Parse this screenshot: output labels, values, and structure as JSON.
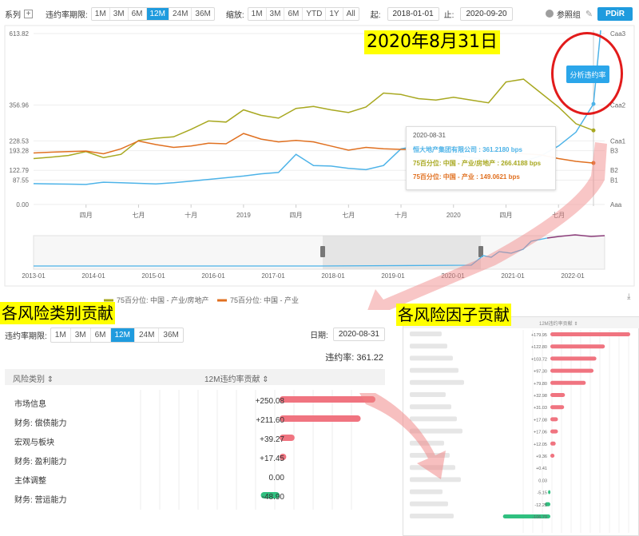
{
  "toolbar": {
    "series_label": "系列",
    "pd_period_label": "违约率期限:",
    "pd_periods": [
      "1M",
      "3M",
      "6M",
      "12M",
      "24M",
      "36M"
    ],
    "pd_period_active": "12M",
    "zoom_label": "缩放:",
    "zoom_options": [
      "1M",
      "3M",
      "6M",
      "YTD",
      "1Y",
      "All"
    ],
    "start_label": "起:",
    "start_date": "2018-01-01",
    "end_label": "止:",
    "end_date": "2020-09-20",
    "ref_group_label": "参照组",
    "pdir_label": "PDiR"
  },
  "annotations": {
    "date_title": "2020年8月31日",
    "left_section_title": "各风险类别贡献",
    "right_section_title": "各风险因子贡献"
  },
  "main_chart": {
    "y_left_ticks": [
      "613.82",
      "356.96",
      "228.53",
      "193.28",
      "122.79",
      "87.55",
      "0.00"
    ],
    "y_right_ticks": [
      "Caa3",
      "Caa2",
      "Caa1",
      "B3",
      "B2",
      "B1",
      "Aaa"
    ],
    "x_ticks": [
      "四月",
      "七月",
      "十月",
      "2019",
      "四月",
      "七月",
      "十月",
      "2020",
      "四月",
      "七月"
    ],
    "analyze_button": "分析违约率",
    "tooltip": {
      "date": "2020-08-31",
      "rows": [
        {
          "text": "恒大地产集团有限公司 : 361.2180 bps",
          "color": "#4db3e8"
        },
        {
          "text": "75百分位: 中国 - 产业/房地产 : 266.4188 bps",
          "color": "#a8a820"
        },
        {
          "text": "75百分位: 中国 - 产业 : 149.0621 bps",
          "color": "#e07020"
        }
      ]
    },
    "navigator_ticks": [
      "2013-01",
      "2014-01",
      "2015-01",
      "2016-01",
      "2017-01",
      "2018-01",
      "2019-01",
      "2020-01",
      "2021-01",
      "2022-01"
    ],
    "legend": [
      {
        "name": "75百分位: 中国 - 产业/房地产",
        "color": "#a8a820"
      },
      {
        "name": "75百分位: 中国 - 产业",
        "color": "#e07020"
      }
    ],
    "colors": {
      "company": "#4db3e8",
      "industry_re": "#a8a820",
      "industry": "#e07020",
      "forecast": "#8b3d7a"
    }
  },
  "chart_data": [
    {
      "type": "line",
      "title": "",
      "x": [
        "2018-01",
        "2018-02",
        "2018-03",
        "2018-04",
        "2018-05",
        "2018-06",
        "2018-07",
        "2018-08",
        "2018-09",
        "2018-10",
        "2018-11",
        "2018-12",
        "2019-01",
        "2019-02",
        "2019-03",
        "2019-04",
        "2019-05",
        "2019-06",
        "2019-07",
        "2019-08",
        "2019-09",
        "2019-10",
        "2019-11",
        "2019-12",
        "2020-01",
        "2020-02",
        "2020-03",
        "2020-04",
        "2020-05",
        "2020-06",
        "2020-07",
        "2020-08",
        "2020-08-31"
      ],
      "series": [
        {
          "name": "恒大地产集团有限公司",
          "values": [
            75,
            74,
            73,
            72,
            80,
            78,
            76,
            74,
            78,
            84,
            90,
            96,
            102,
            110,
            115,
            180,
            140,
            138,
            130,
            125,
            140,
            200,
            210,
            205,
            180,
            168,
            160,
            148,
            155,
            175,
            210,
            260,
            361
          ]
        },
        {
          "name": "75百分位: 中国 - 产业/房地产",
          "values": [
            165,
            170,
            176,
            190,
            168,
            180,
            230,
            238,
            243,
            270,
            300,
            296,
            340,
            320,
            310,
            345,
            352,
            340,
            330,
            350,
            400,
            395,
            380,
            375,
            385,
            375,
            365,
            440,
            450,
            400,
            350,
            290,
            266
          ]
        },
        {
          "name": "75百分位: 中国 - 产业",
          "values": [
            185,
            188,
            190,
            192,
            182,
            200,
            228,
            215,
            205,
            210,
            220,
            218,
            255,
            235,
            225,
            230,
            225,
            210,
            195,
            205,
            200,
            198,
            198,
            205,
            210,
            200,
            198,
            188,
            182,
            178,
            165,
            155,
            149
          ]
        }
      ],
      "ylim": [
        0,
        613.82
      ]
    },
    {
      "type": "bar",
      "title": "",
      "categories": [
        "市场信息",
        "财务: 偿债能力",
        "宏观与板块",
        "财务: 盈利能力",
        "主体调整",
        "财务: 营运能力"
      ],
      "values": [
        250.08,
        211.6,
        39.27,
        17.45,
        0.0,
        -48.9
      ]
    },
    {
      "type": "bar",
      "title": "",
      "categories": [],
      "values": [
        179.95,
        122.8,
        103.72,
        97.3,
        79.8,
        32.98,
        31.03,
        17.08,
        17.06,
        12.05,
        9.36,
        0.41,
        0.03,
        -5.15,
        -12.25,
        -106.79
      ]
    }
  ],
  "risk_panel": {
    "pd_period_label": "违约率期限:",
    "pd_periods": [
      "1M",
      "3M",
      "6M",
      "12M",
      "24M",
      "36M"
    ],
    "pd_period_active": "12M",
    "date_label": "日期:",
    "date_value": "2020-08-31",
    "pd_label": "违约率: 361.22",
    "col_category": "风险类别 ⇕",
    "col_contribution": "12M违约率贡献 ⇕",
    "rows": [
      {
        "name": "市场信息",
        "value": "+250.08"
      },
      {
        "name": "财务: 偿债能力",
        "value": "+211.60"
      },
      {
        "name": "宏观与板块",
        "value": "+39.27"
      },
      {
        "name": "财务: 盈利能力",
        "value": "+17.45"
      },
      {
        "name": "主体调整",
        "value": "0.00"
      },
      {
        "name": "财务: 营运能力",
        "value": "-48.90"
      }
    ]
  },
  "factor_panel": {
    "header": "12M违约率贡献 ⇕",
    "values": [
      "+179.95",
      "+122.80",
      "+103.72",
      "+97.30",
      "+79.80",
      "+32.98",
      "+31.03",
      "+17.08",
      "+17.06",
      "+12.05",
      "+9.36",
      "+0.41",
      "0.03",
      "-5.15",
      "-12.25",
      "-106.79"
    ]
  }
}
